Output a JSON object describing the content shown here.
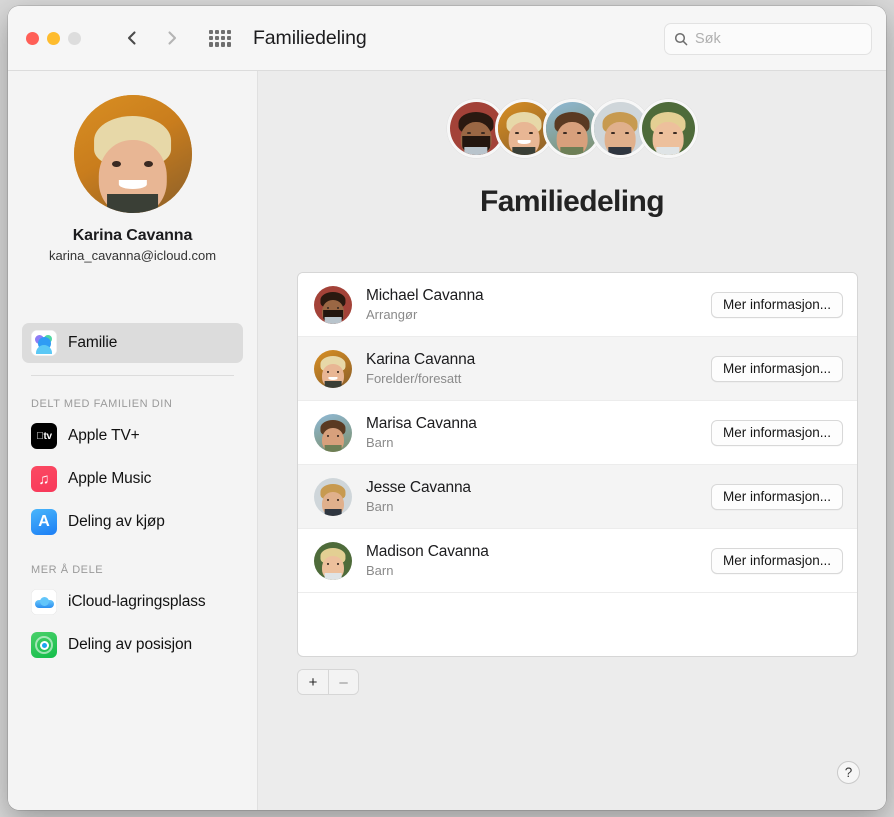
{
  "window": {
    "title": "Familiedeling",
    "traffic_lights": [
      "close",
      "minimize",
      "zoom"
    ],
    "back_label": "Tilbake",
    "forward_label": "Fram",
    "grid_label": "Vis alle"
  },
  "search": {
    "placeholder": "Søk",
    "value": ""
  },
  "sidebar": {
    "profile": {
      "name": "Karina Cavanna",
      "email": "karina_cavanna@icloud.com"
    },
    "primary": [
      {
        "label": "Familie",
        "icon": "family-icon",
        "selected": true
      }
    ],
    "sections": [
      {
        "header": "DELT MED FAMILIEN DIN",
        "items": [
          {
            "label": "Apple TV+",
            "icon": "apple-tv-icon"
          },
          {
            "label": "Apple Music",
            "icon": "apple-music-icon"
          },
          {
            "label": "Deling av kjøp",
            "icon": "app-store-icon"
          }
        ]
      },
      {
        "header": "MER Å DELE",
        "items": [
          {
            "label": "iCloud-lagringsplass",
            "icon": "icloud-icon"
          },
          {
            "label": "Deling av posisjon",
            "icon": "find-my-icon"
          }
        ]
      }
    ]
  },
  "main": {
    "title": "Familiedeling",
    "cluster_count": 5,
    "members": [
      {
        "name": "Michael Cavanna",
        "role": "Arrangør",
        "button": "Mer informasjon..."
      },
      {
        "name": "Karina Cavanna",
        "role": "Forelder/foresatt",
        "button": "Mer informasjon..."
      },
      {
        "name": "Marisa Cavanna",
        "role": "Barn",
        "button": "Mer informasjon..."
      },
      {
        "name": "Jesse Cavanna",
        "role": "Barn",
        "button": "Mer informasjon..."
      },
      {
        "name": "Madison Cavanna",
        "role": "Barn",
        "button": "Mer informasjon..."
      }
    ],
    "add_label": "+",
    "remove_label": "–",
    "help_label": "?"
  },
  "colors": {
    "window_bg": "#ececec",
    "sidebar_bg": "#f4f4f4",
    "titlebar_bg": "#f6f6f6",
    "selection": "#dcdcdc",
    "row_alt": "#f4f4f4",
    "text_primary": "#1c1c1e",
    "text_secondary": "#8a8a8a"
  }
}
